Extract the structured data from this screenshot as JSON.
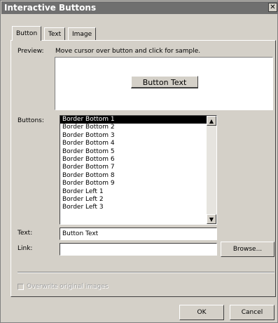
{
  "window": {
    "title": "Interactive Buttons",
    "close_glyph": "✕"
  },
  "tabs": [
    {
      "label": "Button",
      "active": true
    },
    {
      "label": "Text",
      "active": false
    },
    {
      "label": "Image",
      "active": false
    }
  ],
  "preview": {
    "label": "Preview:",
    "instruction": "Move cursor over button and click for sample.",
    "sample_button_text": "Button Text"
  },
  "buttons_list": {
    "label": "Buttons:",
    "items": [
      "Border Bottom 1",
      "Border Bottom 2",
      "Border Bottom 3",
      "Border Bottom 4",
      "Border Bottom 5",
      "Border Bottom 6",
      "Border Bottom 7",
      "Border Bottom 8",
      "Border Bottom 9",
      "Border Left 1",
      "Border Left 2",
      "Border Left 3"
    ],
    "selected_index": 0
  },
  "text_field": {
    "label": "Text:",
    "value": "Button Text"
  },
  "link_field": {
    "label": "Link:",
    "value": "",
    "browse_label": "Browse..."
  },
  "overwrite": {
    "label": "Overwrite original images",
    "checked": false,
    "enabled": false
  },
  "footer": {
    "ok_label": "OK",
    "cancel_label": "Cancel"
  },
  "icons": {
    "scroll_up": "▲",
    "scroll_down": "▼"
  }
}
